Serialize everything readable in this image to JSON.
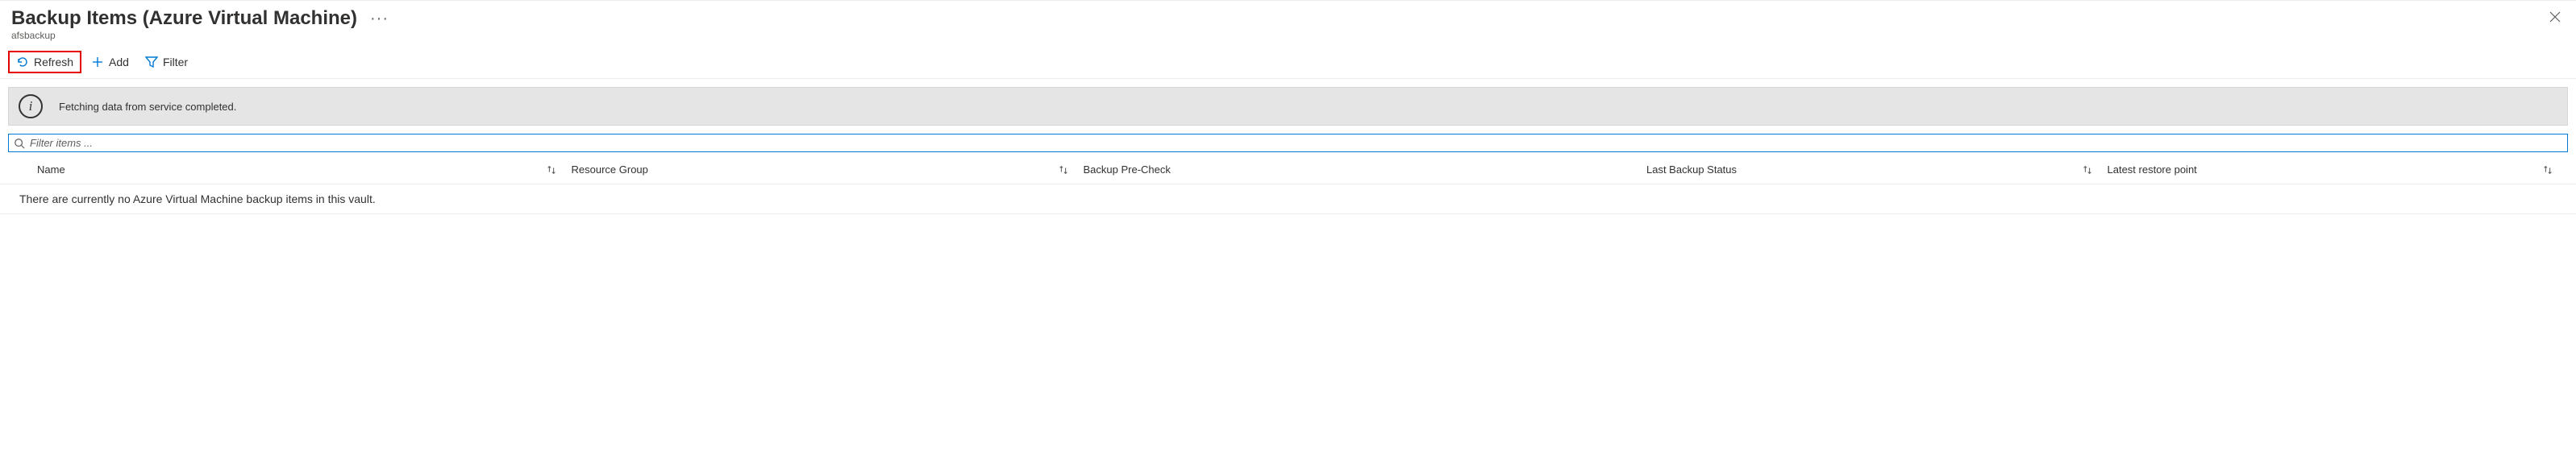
{
  "header": {
    "title": "Backup Items (Azure Virtual Machine)",
    "subtitle": "afsbackup",
    "more_label": "···"
  },
  "commands": {
    "refresh": "Refresh",
    "add": "Add",
    "filter": "Filter"
  },
  "banner": {
    "message": "Fetching data from service completed."
  },
  "filter_input": {
    "placeholder": "Filter items ..."
  },
  "columns": {
    "name": "Name",
    "resource_group": "Resource Group",
    "pre_check": "Backup Pre-Check",
    "last_status": "Last Backup Status",
    "latest_point": "Latest restore point"
  },
  "empty_state": "There are currently no Azure Virtual Machine backup items in this vault."
}
